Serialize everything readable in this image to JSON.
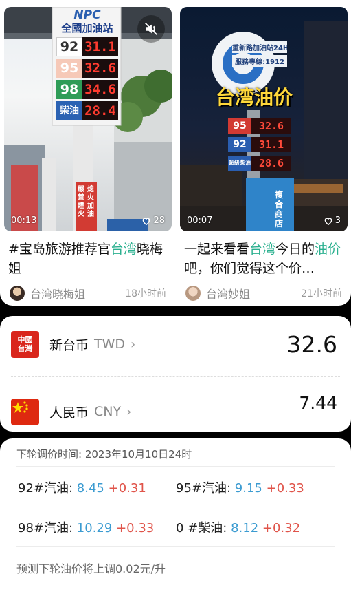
{
  "feed": {
    "cards": [
      {
        "duration": "00:13",
        "likes": "28",
        "title_prefix": "#宝岛旅游推荐官",
        "title_highlight": "台湾",
        "title_suffix": "晓梅姐",
        "author": "台湾晓梅姐",
        "time": "18小时前",
        "sign_brand": "NPC",
        "sign_station": "全國加油站",
        "sign_rows": [
          {
            "grade": "92",
            "price": "31.1"
          },
          {
            "grade": "95",
            "price": "32.6"
          },
          {
            "grade": "98",
            "price": "34.6"
          },
          {
            "grade": "柴油",
            "price": "28.4"
          }
        ],
        "side_sign": "嚴禁煙火",
        "side_sign2": "熄火加油"
      },
      {
        "duration": "00:07",
        "likes": "3",
        "title_prefix": "一起来看看",
        "title_highlight": "台湾",
        "title_mid": "今日的",
        "title_highlight2": "油价",
        "title_suffix": "吧，你们觉得这个价…",
        "author": "台湾妙姐",
        "time": "21小时前",
        "overlay_caption": "台湾油价",
        "sign_top": [
          "重新路加油站24H",
          "服務專線:1912"
        ],
        "sign_rows": [
          {
            "grade": "95",
            "price": "32.6"
          },
          {
            "grade": "92",
            "price": "31.1"
          },
          {
            "grade": "超級柴油",
            "price": "28.6"
          }
        ],
        "shop_sign": "複合商店"
      }
    ]
  },
  "exchange": {
    "rows": [
      {
        "flag": "中國台灣",
        "name": "新台币",
        "code": "TWD",
        "value": "32.6"
      },
      {
        "flag": "china-flag",
        "name": "人民币",
        "code": "CNY",
        "value": "7.44"
      }
    ]
  },
  "oil": {
    "next_adjust": "下轮调价时间: 2023年10月10日24时",
    "items": [
      {
        "label": "92#汽油:",
        "price": "8.45",
        "delta": "+0.31"
      },
      {
        "label": "95#汽油:",
        "price": "9.15",
        "delta": "+0.33"
      },
      {
        "label": "98#汽油:",
        "price": "10.29",
        "delta": "+0.33"
      },
      {
        "label": "0 #柴油:",
        "price": "8.12",
        "delta": "+0.32"
      }
    ],
    "forecast": "预测下轮油价将上调0.02元/升"
  },
  "colors": {
    "accent_green": "#2bb08f",
    "price_blue": "#3b9bd1",
    "delta_red": "#e0544a"
  }
}
